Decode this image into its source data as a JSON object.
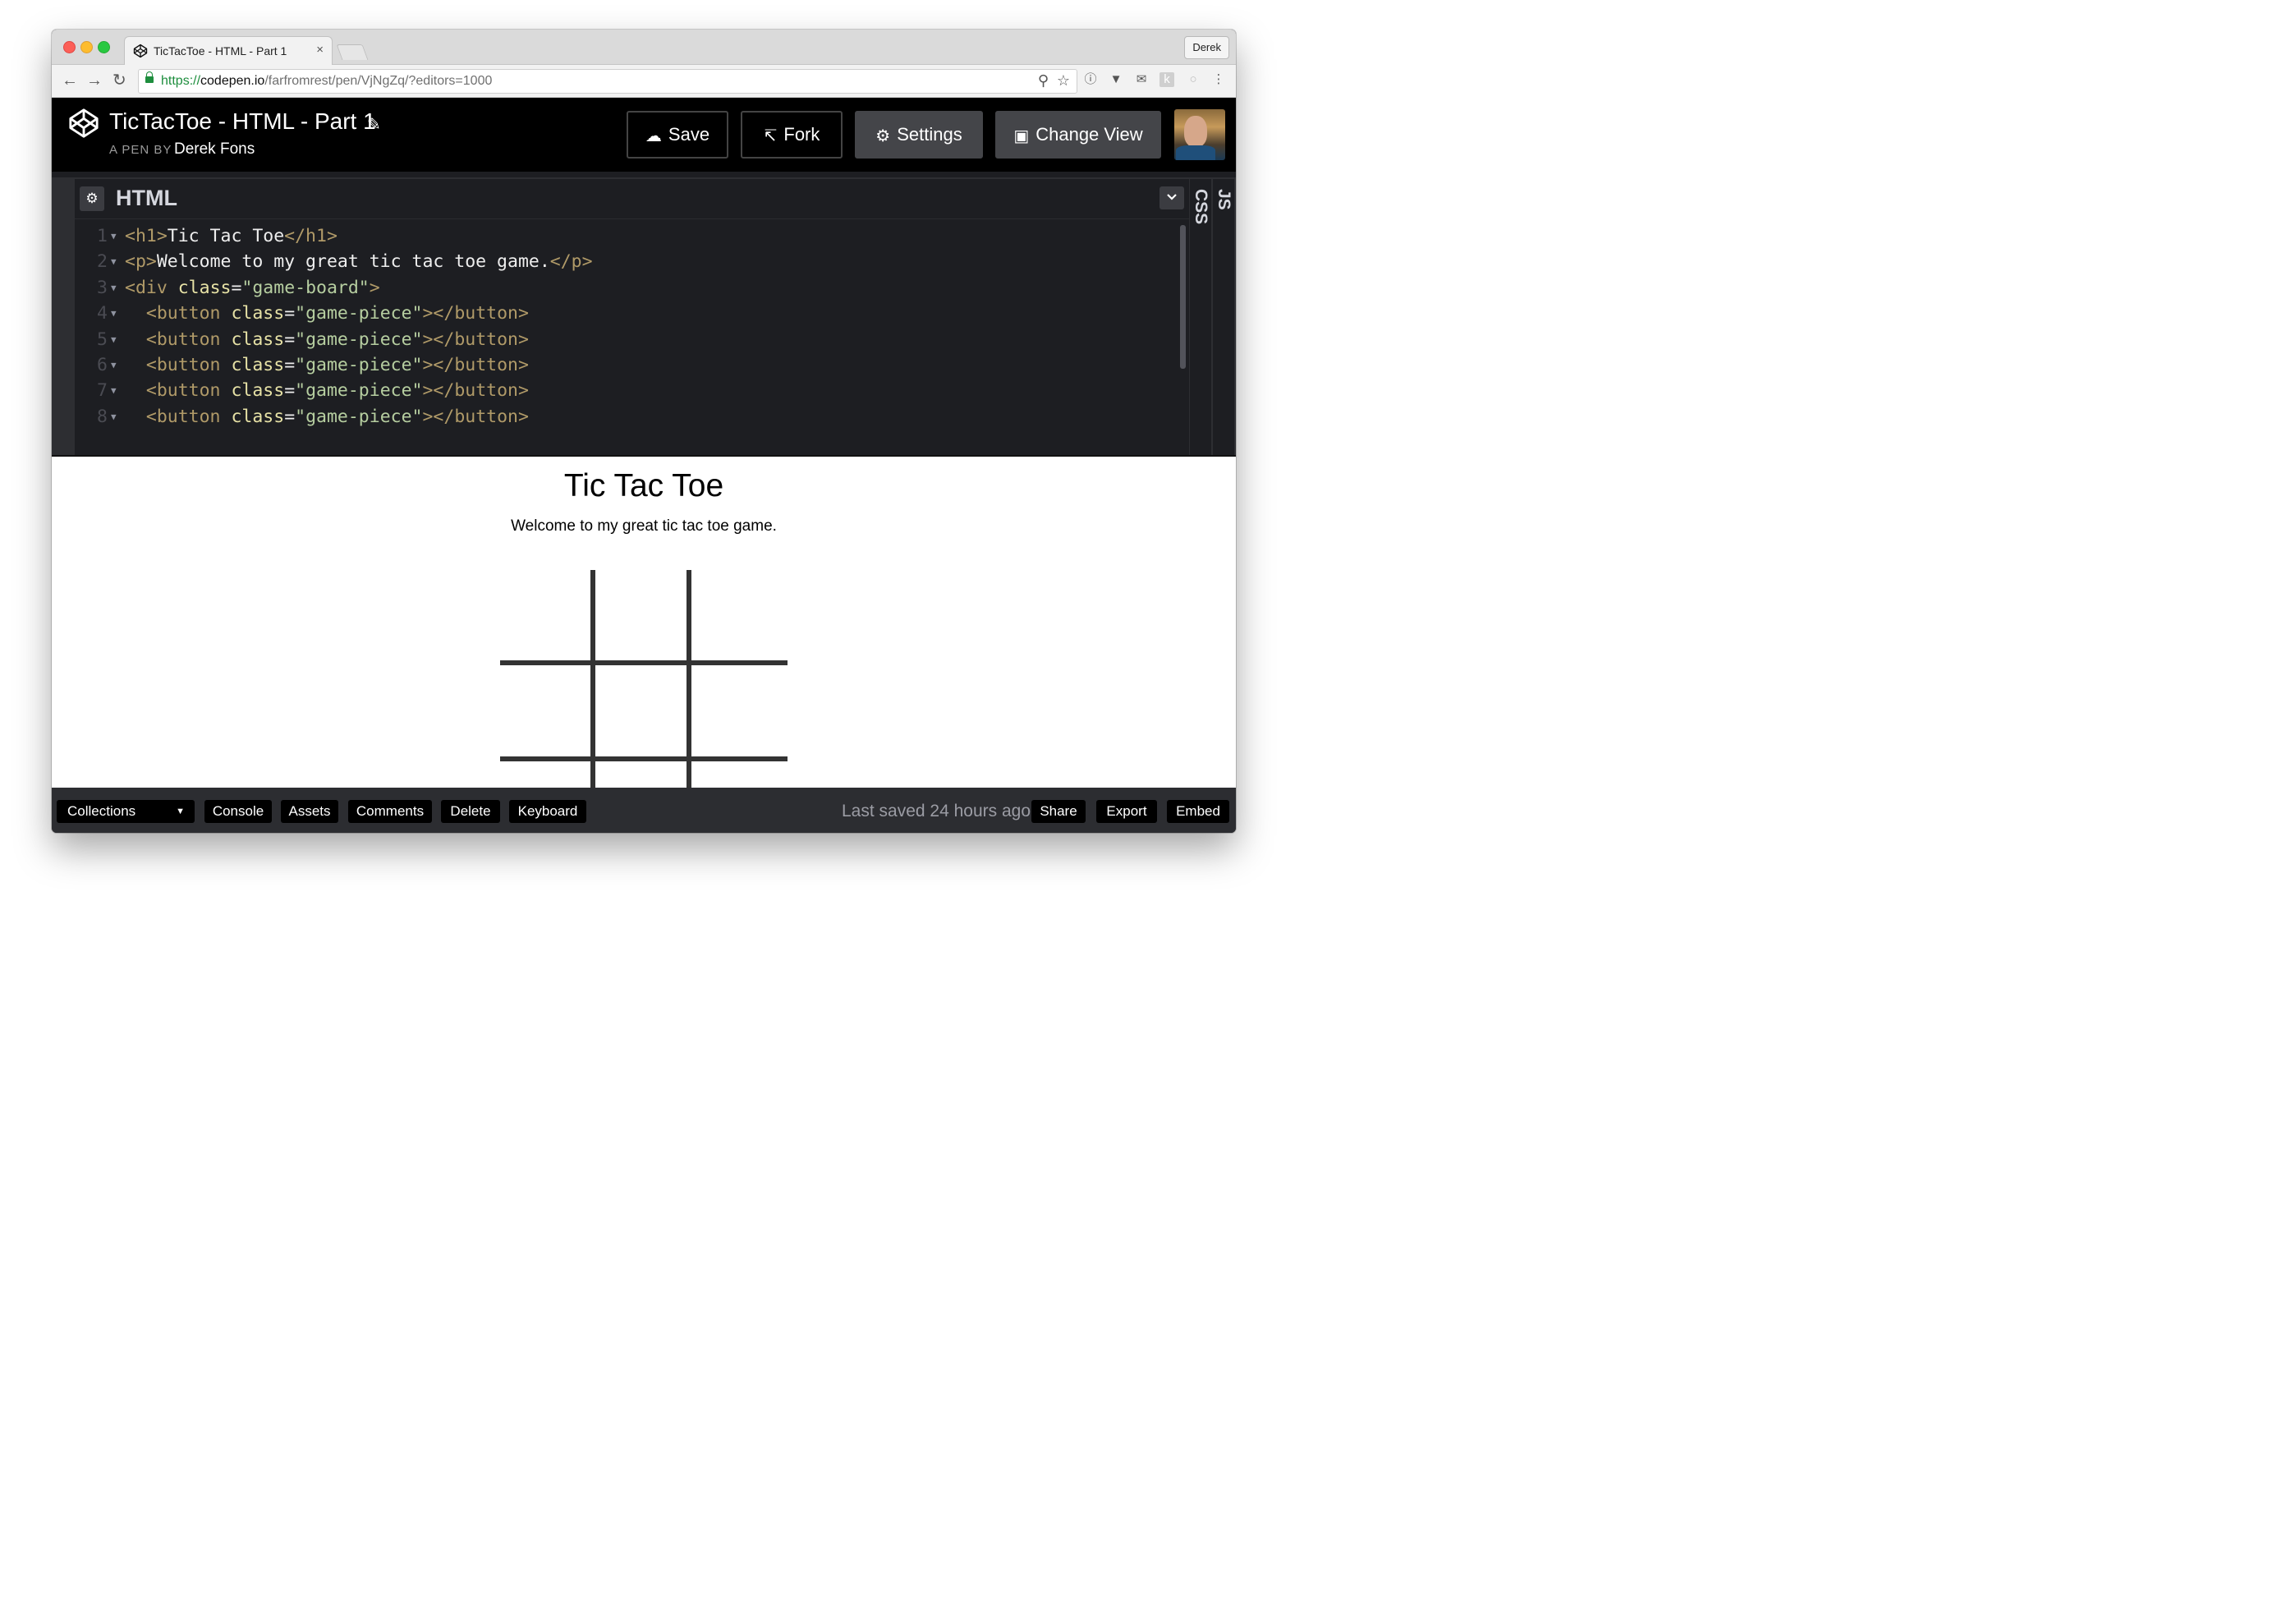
{
  "browser": {
    "tab_title": "TicTacToe - HTML - Part 1",
    "tab_close": "×",
    "profile_name": "Derek",
    "url_scheme": "https://",
    "url_host": "codepen.io",
    "url_path": "/farfromrest/pen/VjNgZq/?editors=1000"
  },
  "pen": {
    "title": "TicTacToe - HTML - Part 1",
    "by_label": "A PEN BY",
    "author": "Derek Fons"
  },
  "header_buttons": {
    "save": "Save",
    "fork": "Fork",
    "settings": "Settings",
    "change_view": "Change View"
  },
  "editor": {
    "title": "HTML",
    "side_tabs": [
      "CSS",
      "JS"
    ],
    "line_numbers": [
      "1",
      "2",
      "3",
      "4",
      "5",
      "6",
      "7",
      "8"
    ],
    "lines": [
      [
        {
          "t": "tag",
          "v": "<h1>"
        },
        {
          "t": "txt",
          "v": "Tic Tac Toe"
        },
        {
          "t": "tag",
          "v": "</h1>"
        }
      ],
      [
        {
          "t": "tag",
          "v": "<p>"
        },
        {
          "t": "txt",
          "v": "Welcome to my great tic tac toe game."
        },
        {
          "t": "tag",
          "v": "</p>"
        }
      ],
      [
        {
          "t": "tag",
          "v": "<div "
        },
        {
          "t": "attr",
          "v": "class"
        },
        {
          "t": "txt",
          "v": "="
        },
        {
          "t": "str",
          "v": "\"game-board\""
        },
        {
          "t": "tag",
          "v": ">"
        }
      ],
      [
        {
          "t": "txt",
          "v": "  "
        },
        {
          "t": "tag",
          "v": "<button "
        },
        {
          "t": "attr",
          "v": "class"
        },
        {
          "t": "txt",
          "v": "="
        },
        {
          "t": "str",
          "v": "\"game-piece\""
        },
        {
          "t": "tag",
          "v": "></button>"
        }
      ],
      [
        {
          "t": "txt",
          "v": "  "
        },
        {
          "t": "tag",
          "v": "<button "
        },
        {
          "t": "attr",
          "v": "class"
        },
        {
          "t": "txt",
          "v": "="
        },
        {
          "t": "str",
          "v": "\"game-piece\""
        },
        {
          "t": "tag",
          "v": "></button>"
        }
      ],
      [
        {
          "t": "txt",
          "v": "  "
        },
        {
          "t": "tag",
          "v": "<button "
        },
        {
          "t": "attr",
          "v": "class"
        },
        {
          "t": "txt",
          "v": "="
        },
        {
          "t": "str",
          "v": "\"game-piece\""
        },
        {
          "t": "tag",
          "v": "></button>"
        }
      ],
      [
        {
          "t": "txt",
          "v": "  "
        },
        {
          "t": "tag",
          "v": "<button "
        },
        {
          "t": "attr",
          "v": "class"
        },
        {
          "t": "txt",
          "v": "="
        },
        {
          "t": "str",
          "v": "\"game-piece\""
        },
        {
          "t": "tag",
          "v": "></button>"
        }
      ],
      [
        {
          "t": "txt",
          "v": "  "
        },
        {
          "t": "tag",
          "v": "<button "
        },
        {
          "t": "attr",
          "v": "class"
        },
        {
          "t": "txt",
          "v": "="
        },
        {
          "t": "str",
          "v": "\"game-piece\""
        },
        {
          "t": "tag",
          "v": "></button>"
        }
      ]
    ]
  },
  "preview": {
    "title": "Tic Tac Toe",
    "subtitle": "Welcome to my great tic tac toe game."
  },
  "footer": {
    "collections": "Collections",
    "console": "Console",
    "assets": "Assets",
    "comments": "Comments",
    "delete": "Delete",
    "keyboard": "Keyboard",
    "last_saved": "Last saved 24 hours ago",
    "share": "Share",
    "export": "Export",
    "embed": "Embed"
  },
  "icons": {
    "codepen_logo": "codepen-logo-icon",
    "pencil": "pencil-icon",
    "cloud": "cloud-icon",
    "fork": "fork-icon",
    "gear": "gear-icon",
    "eye": "eye-icon",
    "chevron": "chevron-down-icon"
  },
  "colors": {
    "header_bg": "#000000",
    "editor_bg": "#1d1e22",
    "tag": "#b09a68",
    "attr": "#e7e2a6",
    "string": "#b6cea0",
    "text": "#eeeeee",
    "board_line": "#333333"
  }
}
